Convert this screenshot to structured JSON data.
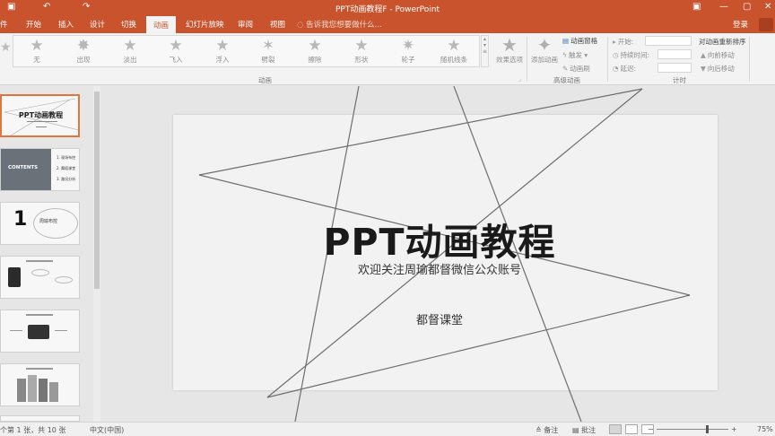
{
  "titlebar": {
    "title": "PPT动画教程F - PowerPoint",
    "save_icon": "save-icon",
    "undo_icon": "undo-icon",
    "redo_icon": "redo-icon",
    "restore_icon": "ribbon-display-icon",
    "minimize_icon": "minimize-icon",
    "maximize_icon": "maximize-icon",
    "close_icon": "close-icon"
  },
  "tabs": {
    "file": "件",
    "home": "开始",
    "insert": "插入",
    "design": "设计",
    "transitions": "切换",
    "animations": "动画",
    "slideshow": "幻灯片放映",
    "review": "审阅",
    "view": "视图",
    "tell": "告诉我您想要做什么...",
    "login": "登录"
  },
  "ribbon": {
    "animations": [
      "无",
      "出现",
      "淡出",
      "飞入",
      "浮入",
      "劈裂",
      "擦除",
      "形状",
      "轮子",
      "随机线条"
    ],
    "effect_options": "效果选项",
    "add_animation": "添加动画",
    "animation_pane": "动画窗格",
    "trigger": "触发",
    "animation_painter": "动画刷",
    "start_label": "开始:",
    "duration_label": "持续时间:",
    "delay_label": "延迟:",
    "reorder_title": "对动画重新排序",
    "move_earlier": "向前移动",
    "move_later": "向后移动",
    "group_animation": "动画",
    "group_advanced": "高级动画",
    "group_timing": "计时"
  },
  "thumbnails": {
    "slide1_title": "PPT动画教程",
    "slide2_label": "CONTENTS",
    "slide2_items": [
      "1. 现场布控",
      "2. 舞蹈课堂",
      "3. 路况分析"
    ],
    "slide3_num": "1",
    "slide3_text": "周瑜布控"
  },
  "slide": {
    "title": "PPT动画教程",
    "subtitle": "欢迎关注周瑜都督微信公众账号",
    "brand": "都督课堂"
  },
  "status": {
    "slide_info": "个第 1 张，共 10 张",
    "language": "中文(中国)",
    "notes": "备注",
    "comments": "批注",
    "zoom": "75%"
  }
}
